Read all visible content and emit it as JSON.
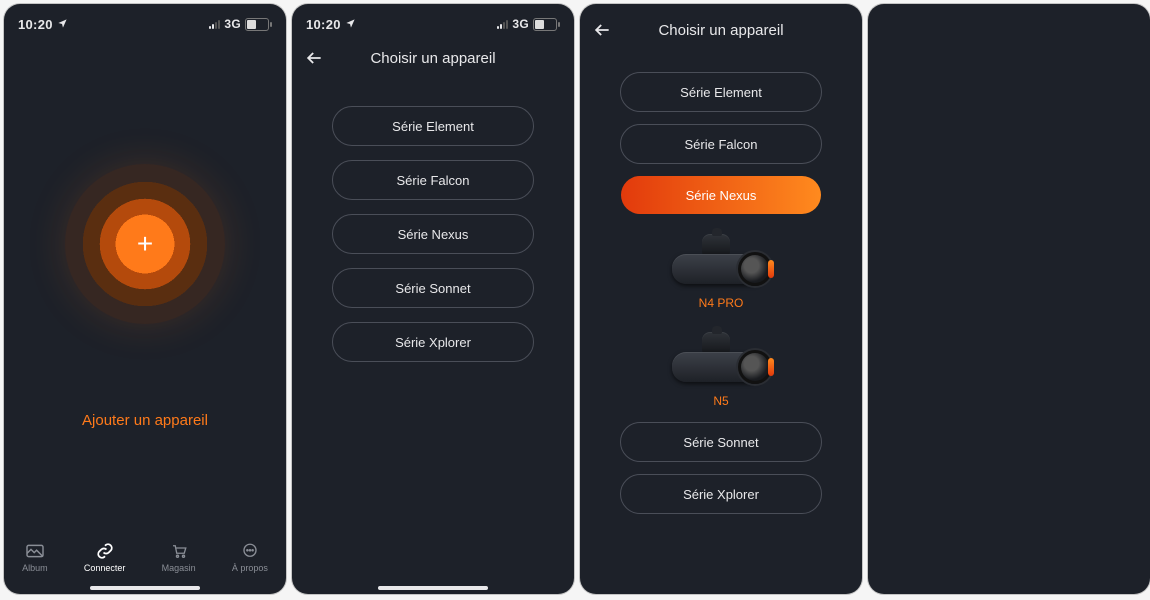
{
  "status": {
    "time": "10:20",
    "network": "3G",
    "battery_text": "41"
  },
  "screen1": {
    "add_label": "Ajouter un appareil",
    "tabs": {
      "album": "Album",
      "connect": "Connecter",
      "store": "Magasin",
      "about": "À propos"
    }
  },
  "screen2": {
    "title": "Choisir un appareil",
    "series": [
      "Série Element",
      "Série Falcon",
      "Série Nexus",
      "Série Sonnet",
      "Série Xplorer"
    ]
  },
  "screen3": {
    "title": "Choisir un appareil",
    "series_top": [
      "Série Element",
      "Série Falcon"
    ],
    "series_active": "Série Nexus",
    "devices": [
      "N4 PRO",
      "N5"
    ],
    "series_bottom": [
      "Série Sonnet",
      "Série Xplorer"
    ]
  }
}
